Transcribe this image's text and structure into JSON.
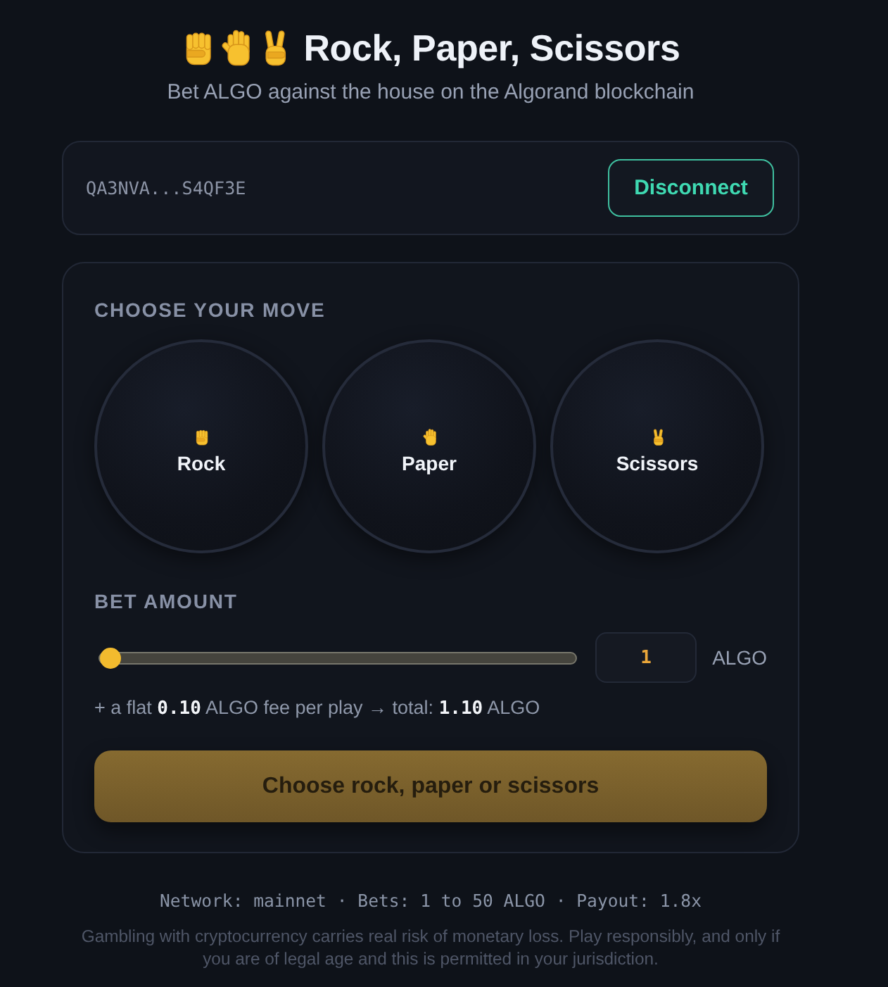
{
  "header": {
    "icons": [
      {
        "kind": "rock"
      },
      {
        "kind": "paper"
      },
      {
        "kind": "scissors"
      }
    ],
    "title": "Rock, Paper, Scissors",
    "subtitle": "Bet ALGO against the house on the Algorand blockchain"
  },
  "wallet": {
    "address": "QA3NVA...S4QF3E",
    "disconnect_button": "Disconnect"
  },
  "move_section": {
    "heading": "CHOOSE YOUR MOVE",
    "moves": [
      {
        "kind": "rock",
        "label": "Rock",
        "selected": false
      },
      {
        "kind": "paper",
        "label": "Paper",
        "selected": false
      },
      {
        "kind": "scissors",
        "label": "Scissors",
        "selected": false
      }
    ]
  },
  "bet": {
    "heading": "BET AMOUNT",
    "slider": {
      "level": 0
    },
    "amount": "1",
    "unit": "ALGO",
    "fee_note": "+ a flat **0.10** ALGO fee per play → total: **1.10** ALGO"
  },
  "play_button": {
    "label": "Choose rock, paper or scissors",
    "disabled": true
  },
  "footer": {
    "network_info": "Network: mainnet · Bets: 1 to 50 ALGO · Payout: 1.8x",
    "disclaimer": "Gambling with cryptocurrency carries real risk of monetary loss. Play responsibly, and only if you are of legal age and this is permitted in your jurisdiction."
  }
}
